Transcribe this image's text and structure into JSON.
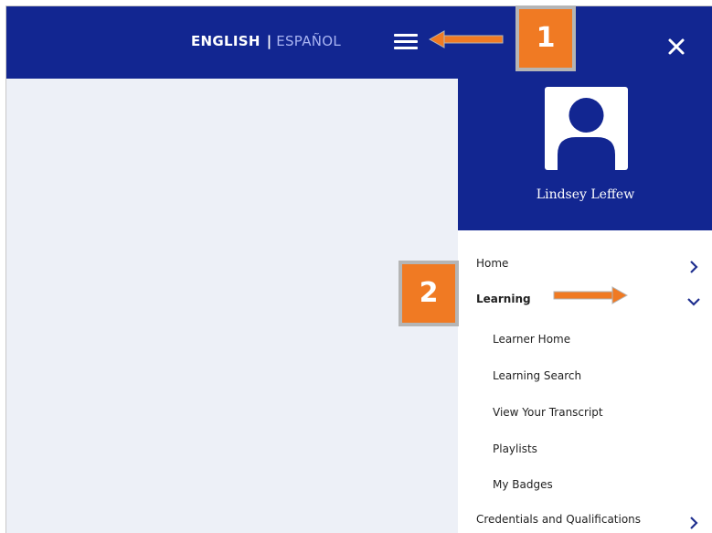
{
  "header": {
    "lang_english": "ENGLISH",
    "lang_separator": "|",
    "lang_spanish": "ESPAÑOL"
  },
  "profile": {
    "name": "Lindsey Leffew"
  },
  "menu": {
    "home": "Home",
    "learning": "Learning",
    "learning_items": [
      "Learner Home",
      "Learning Search",
      "View Your Transcript",
      "Playlists",
      "My Badges"
    ],
    "credentials": "Credentials and Qualifications"
  },
  "callouts": {
    "one": "1",
    "two": "2"
  },
  "colors": {
    "nav_blue": "#122691",
    "spanish_link": "#a9b4f2",
    "callout_orange": "#f07a23",
    "chevron": "#1f2f8f"
  }
}
